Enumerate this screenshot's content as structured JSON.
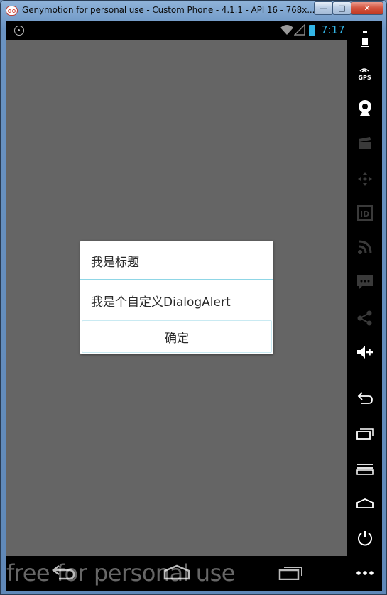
{
  "window": {
    "title": "Genymotion for personal use - Custom Phone - 4.1.1 - API 16 - 768x...",
    "controls": {
      "minimize": "—",
      "maximize": "□",
      "close": "✕"
    }
  },
  "statusbar": {
    "time": "7:17",
    "icons": [
      "gps-icon",
      "wifi-icon",
      "signal-icon",
      "battery-icon"
    ],
    "accent_color": "#33b5e5"
  },
  "dialog": {
    "title": "我是标题",
    "message": "我是个自定义DialogAlert",
    "confirm_label": "确定"
  },
  "watermark": "free for personal use",
  "navbar": {
    "icons": [
      "back-icon",
      "home-icon",
      "recent-apps-icon"
    ]
  },
  "sidebar": {
    "gps_label": "GPS",
    "id_label": "ID",
    "items": [
      "battery-icon",
      "gps-icon",
      "camera-icon",
      "video-icon",
      "dpad-icon",
      "device-id-icon",
      "rss-icon",
      "sms-icon",
      "share-icon",
      "volume-up-icon",
      "back-icon",
      "recent-apps-icon",
      "menu-icon",
      "home-icon",
      "power-icon",
      "more-icon"
    ]
  }
}
